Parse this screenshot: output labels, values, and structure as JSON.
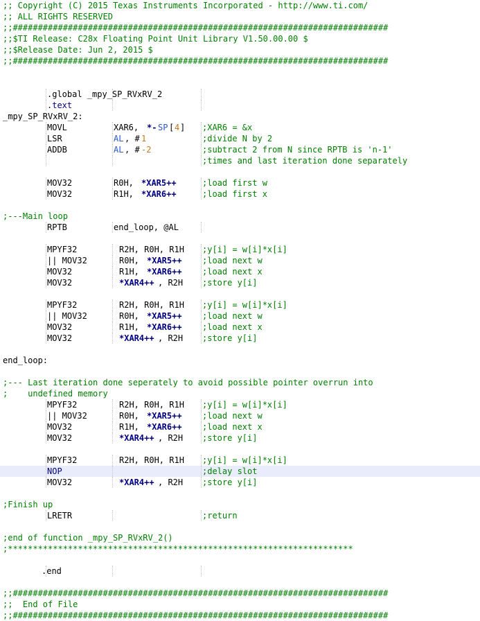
{
  "editor": {
    "language": "TI C28x Assembly",
    "highlight_color": "#e8ecfb",
    "colors": {
      "comment": "#008000",
      "keyword": "#000080",
      "register": "#2a56c6",
      "number": "#c7761b",
      "text": "#000000"
    },
    "lines": [
      [
        [
          ";; Copyright (C) 2015 Texas Instruments Incorporated - http://www.ti.com/",
          "comment",
          0
        ]
      ],
      [
        [
          ";; ALL RIGHTS RESERVED",
          "comment",
          0
        ]
      ],
      [
        [
          ";;###########################################################################",
          "comment",
          0
        ]
      ],
      [
        [
          ";;$TI Release: C28x Floating Point Unit Library V1.50.00.00 $",
          "comment",
          0
        ]
      ],
      [
        [
          ";;$Release Date: Jun 2, 2015 $",
          "comment",
          0
        ]
      ],
      [
        [
          ";;###########################################################################",
          "comment",
          0
        ]
      ],
      [],
      [],
      [
        [
          ".global _mpy_SP_RVxRV_2",
          "plain",
          8
        ]
      ],
      [
        [
          ".text",
          "keyword",
          8
        ]
      ],
      [
        [
          "_mpy_SP_RVxRV_2:",
          "label",
          0
        ]
      ],
      [
        [
          "MOVL",
          "plain",
          8
        ],
        [
          "XAR6, ",
          "plain",
          20
        ],
        [
          "*-",
          "ptr",
          26
        ],
        [
          "SP",
          "reg",
          28
        ],
        [
          "[",
          "plain",
          30
        ],
        [
          "4",
          "num",
          31
        ],
        [
          "]",
          "plain",
          32
        ],
        [
          ";XAR6 = &x",
          "comment",
          36
        ]
      ],
      [
        [
          "LSR",
          "plain",
          8
        ],
        [
          "AL",
          "reg",
          20
        ],
        [
          ", #",
          "plain",
          22
        ],
        [
          "1",
          "num",
          25
        ],
        [
          ";divide N by 2",
          "comment",
          36
        ]
      ],
      [
        [
          "ADDB",
          "plain",
          8
        ],
        [
          "AL",
          "reg",
          20
        ],
        [
          ", #",
          "plain",
          22
        ],
        [
          "-2",
          "num",
          25
        ],
        [
          ";subtract 2 from N since RPTB is 'n-1'",
          "comment",
          36
        ]
      ],
      [
        [
          ";times and last iteration done separately",
          "comment",
          36
        ]
      ],
      [],
      [
        [
          "MOV32",
          "plain",
          8
        ],
        [
          "R0H, ",
          "plain",
          20
        ],
        [
          "*XAR5++",
          "ptr",
          25
        ],
        [
          ";load first w",
          "comment",
          36
        ]
      ],
      [
        [
          "MOV32",
          "plain",
          8
        ],
        [
          "R1H, ",
          "plain",
          20
        ],
        [
          "*XAR6++",
          "ptr",
          25
        ],
        [
          ";load first x",
          "comment",
          36
        ]
      ],
      [],
      [
        [
          ";---Main loop",
          "comment",
          0
        ]
      ],
      [
        [
          "RPTB",
          "plain",
          8
        ],
        [
          "end_loop, @AL",
          "plain",
          20
        ]
      ],
      [],
      [
        [
          "MPYF32",
          "plain",
          8
        ],
        [
          "R2H, R0H, R1H",
          "plain",
          21
        ],
        [
          ";y[i] = w[i]*x[i]",
          "comment",
          36
        ]
      ],
      [
        [
          "|| MOV32",
          "plain",
          8
        ],
        [
          "R0H, ",
          "plain",
          21
        ],
        [
          "*XAR5++",
          "ptr",
          26
        ],
        [
          ";load next w",
          "comment",
          36
        ]
      ],
      [
        [
          "MOV32",
          "plain",
          8
        ],
        [
          "R1H, ",
          "plain",
          21
        ],
        [
          "*XAR6++",
          "ptr",
          26
        ],
        [
          ";load next x",
          "comment",
          36
        ]
      ],
      [
        [
          "MOV32",
          "plain",
          8
        ],
        [
          "*XAR4++",
          "ptr",
          21
        ],
        [
          ", R2H",
          "plain",
          28
        ],
        [
          ";store y[i]",
          "comment",
          36
        ]
      ],
      [],
      [
        [
          "MPYF32",
          "plain",
          8
        ],
        [
          "R2H, R0H, R1H",
          "plain",
          21
        ],
        [
          ";y[i] = w[i]*x[i]",
          "comment",
          36
        ]
      ],
      [
        [
          "|| MOV32",
          "plain",
          8
        ],
        [
          "R0H, ",
          "plain",
          21
        ],
        [
          "*XAR5++",
          "ptr",
          26
        ],
        [
          ";load next w",
          "comment",
          36
        ]
      ],
      [
        [
          "MOV32",
          "plain",
          8
        ],
        [
          "R1H, ",
          "plain",
          21
        ],
        [
          "*XAR6++",
          "ptr",
          26
        ],
        [
          ";load next x",
          "comment",
          36
        ]
      ],
      [
        [
          "MOV32",
          "plain",
          8
        ],
        [
          "*XAR4++",
          "ptr",
          21
        ],
        [
          ", R2H",
          "plain",
          28
        ],
        [
          ";store y[i]",
          "comment",
          36
        ]
      ],
      [],
      [
        [
          "end_loop:",
          "label",
          0
        ]
      ],
      [],
      [
        [
          ";--- Last iteration done seperately to avoid possible pointer overrun into",
          "comment",
          0
        ]
      ],
      [
        [
          ";    undefined memory",
          "comment",
          0
        ]
      ],
      [
        [
          "MPYF32",
          "plain",
          8
        ],
        [
          "R2H, R0H, R1H",
          "plain",
          21
        ],
        [
          ";y[i] = w[i]*x[i]",
          "comment",
          36
        ]
      ],
      [
        [
          "|| MOV32",
          "plain",
          8
        ],
        [
          "R0H, ",
          "plain",
          21
        ],
        [
          "*XAR5++",
          "ptr",
          26
        ],
        [
          ";load next w",
          "comment",
          36
        ]
      ],
      [
        [
          "MOV32",
          "plain",
          8
        ],
        [
          "R1H, ",
          "plain",
          21
        ],
        [
          "*XAR6++",
          "ptr",
          26
        ],
        [
          ";load next x",
          "comment",
          36
        ]
      ],
      [
        [
          "MOV32",
          "plain",
          8
        ],
        [
          "*XAR4++",
          "ptr",
          21
        ],
        [
          ", R2H",
          "plain",
          28
        ],
        [
          ";store y[i]",
          "comment",
          36
        ]
      ],
      [],
      [
        [
          "MPYF32",
          "plain",
          8
        ],
        [
          "R2H, R0H, R1H",
          "plain",
          21
        ],
        [
          ";y[i] = w[i]*x[i]",
          "comment",
          36
        ]
      ],
      [
        [
          "NOP",
          "keyword",
          8
        ],
        [
          ";delay slot",
          "comment",
          36
        ]
      ],
      [
        [
          "MOV32",
          "plain",
          8
        ],
        [
          "*XAR4++",
          "ptr",
          21
        ],
        [
          ", R2H",
          "plain",
          28
        ],
        [
          ";store y[i]",
          "comment",
          36
        ]
      ],
      [],
      [
        [
          ";Finish up",
          "comment",
          0
        ]
      ],
      [
        [
          "LRETR",
          "plain",
          8
        ],
        [
          ";return",
          "comment",
          36
        ]
      ],
      [],
      [
        [
          ";end of function _mpy_SP_RVxRV_2()",
          "comment",
          0
        ]
      ],
      [
        [
          ";*********************************************************************",
          "comment",
          0
        ]
      ],
      [],
      [
        [
          ".end",
          "plain",
          7
        ]
      ],
      [],
      [
        [
          ";;###########################################################################",
          "comment",
          0
        ]
      ],
      [
        [
          ";;  End of File",
          "comment",
          0
        ]
      ],
      [
        [
          ";;###########################################################################",
          "comment",
          0
        ]
      ]
    ],
    "highlighted_line": 42
  }
}
